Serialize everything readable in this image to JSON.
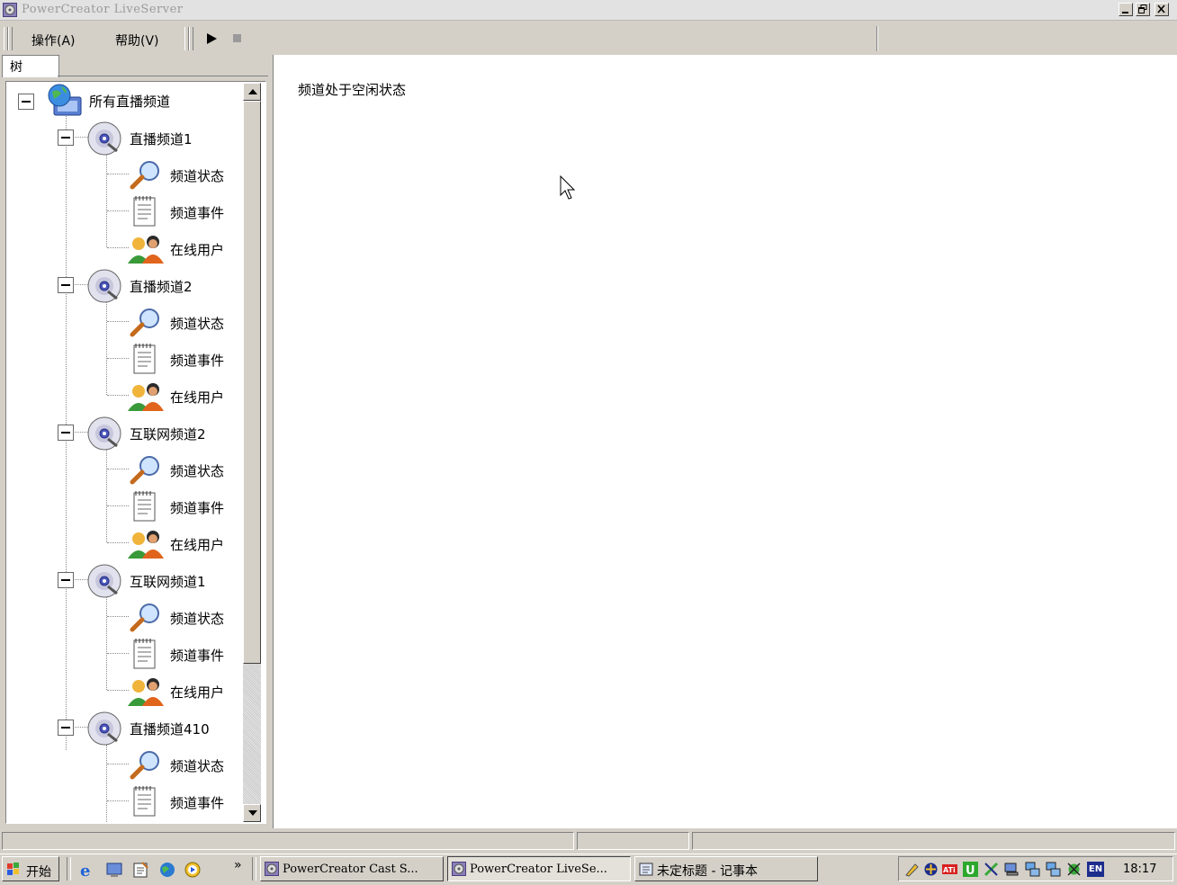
{
  "window": {
    "title": "PowerCreator LiveServer"
  },
  "menubar": {
    "items": [
      "操作(A)",
      "帮助(V)"
    ]
  },
  "left_panel": {
    "tab_label": "树"
  },
  "tree": {
    "root_label": "所有直播频道",
    "channels": [
      {
        "label": "直播频道1",
        "children": [
          "频道状态",
          "频道事件",
          "在线用户"
        ]
      },
      {
        "label": "直播频道2",
        "children": [
          "频道状态",
          "频道事件",
          "在线用户"
        ]
      },
      {
        "label": "互联网频道2",
        "children": [
          "频道状态",
          "频道事件",
          "在线用户"
        ]
      },
      {
        "label": "互联网频道1",
        "children": [
          "频道状态",
          "频道事件",
          "在线用户"
        ]
      },
      {
        "label": "直播频道410",
        "children": [
          "频道状态",
          "频道事件"
        ]
      }
    ]
  },
  "right_panel": {
    "message": "频道处于空闲状态"
  },
  "taskbar": {
    "start_label": "开始",
    "more_label": "»",
    "buttons": [
      "PowerCreator Cast S...",
      "PowerCreator LiveSe...",
      "未定标题 - 记事本"
    ],
    "tray_lang": "EN",
    "clock": "18:17"
  },
  "colors": {
    "title_text": "#9a9a9a",
    "face": "#d4d0c8",
    "taskbar_blue": "#1c2c8c"
  }
}
